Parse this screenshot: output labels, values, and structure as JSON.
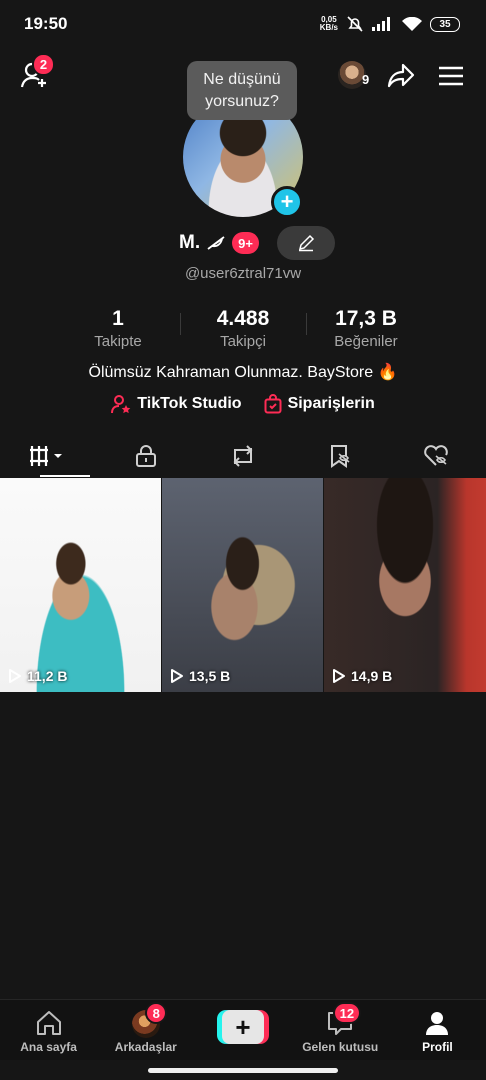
{
  "status_bar": {
    "time": "19:50",
    "net_speed_value": "0,05",
    "net_speed_unit": "KB/s",
    "battery": "35"
  },
  "header": {
    "friends_badge": "2",
    "story_count": "9"
  },
  "tooltip": {
    "line1": "Ne düşünü",
    "line2": "yorsunuz?"
  },
  "profile": {
    "display_name": "M.",
    "name_badge": "9+",
    "username": "@user6ztral71vw",
    "bio": "Ölümsüz Kahraman Olunmaz. BayStore 🔥"
  },
  "stats": [
    {
      "value": "1",
      "label": "Takipte"
    },
    {
      "value": "4.488",
      "label": "Takipçi"
    },
    {
      "value": "17,3 B",
      "label": "Beğeniler"
    }
  ],
  "links": {
    "studio": "TikTok Studio",
    "orders": "Siparişlerin"
  },
  "videos": [
    {
      "views": "11,2 B"
    },
    {
      "views": "13,5 B"
    },
    {
      "views": "14,9 B"
    }
  ],
  "bottom_nav": {
    "home": "Ana sayfa",
    "friends": "Arkadaşlar",
    "friends_badge": "8",
    "inbox": "Gelen kutusu",
    "inbox_badge": "12",
    "profile": "Profil"
  },
  "colors": {
    "accent": "#fe2c55",
    "avatar_add": "#20c4e8",
    "background": "#161616"
  }
}
